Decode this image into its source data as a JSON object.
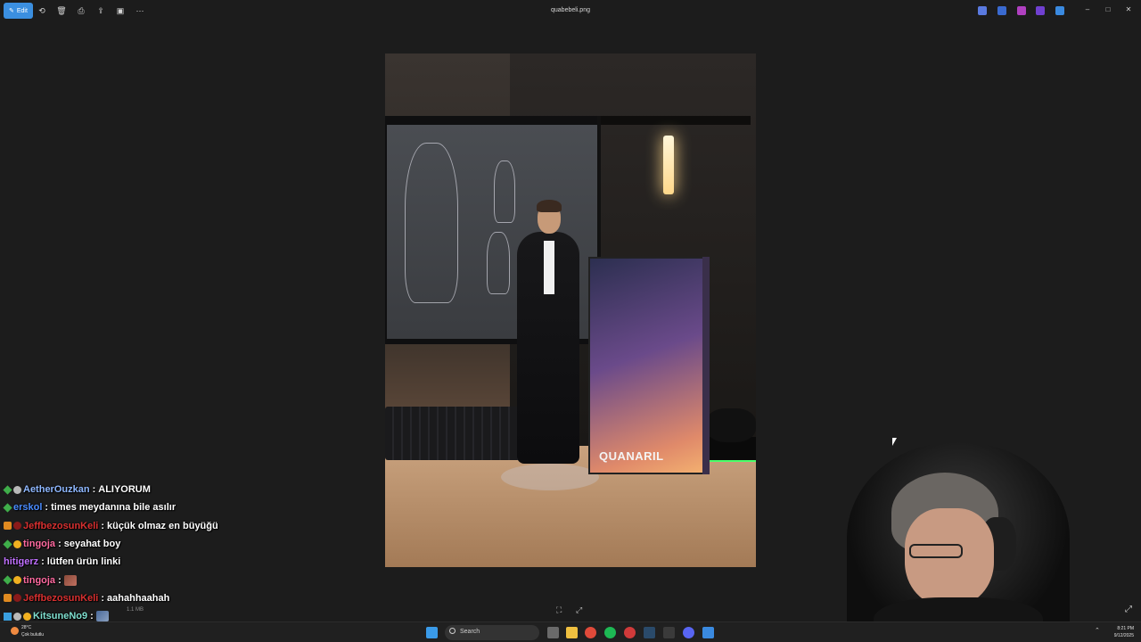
{
  "window": {
    "title": "quabebeli.png",
    "edit_label": "Edit"
  },
  "photo": {
    "box_brand": "QUANARIL"
  },
  "viewer": {
    "file_size": "1.1 MB"
  },
  "chat": {
    "messages": [
      {
        "user": "AetherOuzkan",
        "text": "ALIYORUM",
        "color": "#8fb8ff"
      },
      {
        "user": "erskol",
        "text": "times meydanına bile asılır",
        "color": "#4a8cff"
      },
      {
        "user": "JeffbezosunKeli",
        "text": "küçük olmaz en büyüğü",
        "color": "#d83030"
      },
      {
        "user": "tingoja",
        "text": "seyahat boy",
        "color": "#ff6aa0"
      },
      {
        "user": "hitigerz",
        "text": "lütfen ürün linki",
        "color": "#c070ff"
      },
      {
        "user": "tingoja",
        "text": "",
        "color": "#ff6aa0"
      },
      {
        "user": "JeffbezosunKeli",
        "text": "aahahhaahah",
        "color": "#d83030"
      },
      {
        "user": "KitsuneNo9",
        "text": "",
        "color": "#7fe0d0"
      }
    ]
  },
  "taskbar": {
    "weather_temp": "28°C",
    "weather_desc": "Çok bulutlu",
    "search_placeholder": "Search",
    "time": "8:21 PM",
    "date": "9/12/2025"
  }
}
